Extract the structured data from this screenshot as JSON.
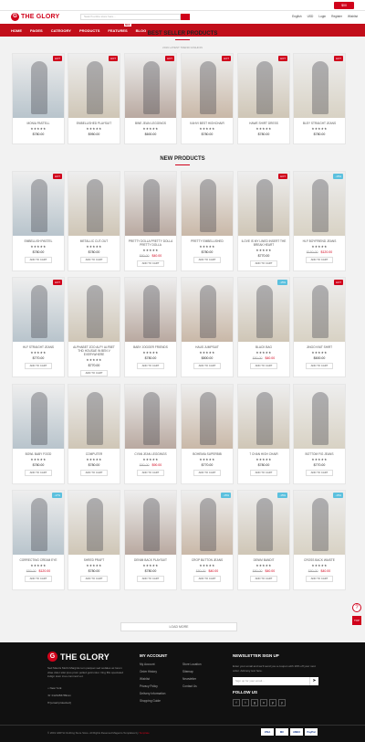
{
  "topbar": {
    "cart_label": "$00"
  },
  "header": {
    "logo_text": "THE GLORY",
    "search_placeholder": "Search entire store here...",
    "links": [
      "English",
      "USD",
      "Login",
      "Register",
      "Wishlist"
    ]
  },
  "nav": {
    "items": [
      "HOME",
      "PAGES",
      "CATEGORY",
      "PRODUCTS",
      "FEATURES",
      "BLOG"
    ],
    "new_badge": "NEW"
  },
  "best": {
    "title": "BEST SELLER PRODUCTS",
    "subtitle": "2019 LATEST TREND FASHION"
  },
  "new_products": {
    "title": "NEW PRODUCTS"
  },
  "stars": "★★★★★",
  "add_to_cart": "ADD TO CART",
  "best_products": [
    {
      "name": "MONIA PASTELL",
      "price": "$780.00",
      "badge": "HOT"
    },
    {
      "name": "EMBELLISHED PLAYSUIT",
      "price": "$950.00",
      "badge": "HOT"
    },
    {
      "name": "BINE JEAN LEGGINGS",
      "price": "$600.00",
      "badge": "HOT"
    },
    {
      "name": "KAHVI BEST HIGHCHAIR",
      "price": "$780.00",
      "badge": "HOT"
    },
    {
      "name": "HAWE SHIRT DRESS",
      "price": "$780.00",
      "badge": "HOT"
    },
    {
      "name": "BLEY STRAIGHT JEANS",
      "price": "$780.00",
      "badge": "HOT"
    }
  ],
  "new_rows": [
    [
      {
        "name": "EMBELLISH PASTEL",
        "price": "$780.00",
        "badge": "HOT"
      },
      {
        "name": "METALLIC CUT-OUT",
        "price": "$780.00",
        "badge": ""
      },
      {
        "name": "PRETTY DOLLA PRETTY DOLLA PRETTY DOLLA",
        "old": "$80.00",
        "price": "$40.00",
        "badge": ""
      },
      {
        "name": "PRETTY EMBELLISHED",
        "price": "$780.00",
        "badge": ""
      },
      {
        "name": "ILOVE IS MY LINED INSERT THE BREAK HEART",
        "price": "$770.00",
        "badge": "HOT"
      },
      {
        "name": "HLF BOYFRIEND JEANS",
        "old": "$150.00",
        "price": "$120.00",
        "badge": "-15%"
      }
    ],
    [
      {
        "name": "HLF STRAIGHT JEANS",
        "price": "$770.00",
        "badge": "HOT"
      },
      {
        "name": "ALPHABET ZOO ALFY ALFBET THD HOUSAE IN BEN V EVERYWHERE",
        "price": "$770.00",
        "badge": ""
      },
      {
        "name": "BABY JOGGER FRIENDS",
        "price": "$780.00",
        "badge": ""
      },
      {
        "name": "HAUS JUMPSUIT",
        "price": "$800.00",
        "badge": ""
      },
      {
        "name": "BLACK BAG",
        "old": "$80.00",
        "price": "$40.00",
        "badge": "-15%"
      },
      {
        "name": "JINGO KNIT SHIRT",
        "price": "$600.00",
        "badge": "HOT"
      }
    ],
    [
      {
        "name": "BOWL BABY FOOD",
        "price": "$780.00",
        "badge": ""
      },
      {
        "name": "COMPUTER",
        "price": "$780.00",
        "badge": ""
      },
      {
        "name": "CYAN JEAN LEGGINGS",
        "old": "$80.00",
        "price": "$90.00",
        "badge": ""
      },
      {
        "name": "BOHEMIA SUPERBIB",
        "price": "$770.00",
        "badge": ""
      },
      {
        "name": "7 CHAN HIGH CHAIR",
        "price": "$780.00",
        "badge": ""
      },
      {
        "name": "BOTTOM FIG JEANS",
        "price": "$770.00",
        "badge": ""
      }
    ],
    [
      {
        "name": "CORRECTING CREAM EYE",
        "old": "$80.00",
        "price": "$120.00",
        "badge": "-17%"
      },
      {
        "name": "SHRED PRAFT",
        "price": "$780.00",
        "badge": ""
      },
      {
        "name": "DENIM BACK PLAYSUIT",
        "price": "$780.00",
        "badge": ""
      },
      {
        "name": "CROP BUTTON JEANS",
        "old": "$80.00",
        "price": "$40.00",
        "badge": "-15%"
      },
      {
        "name": "DENIM BANDIT",
        "old": "$80.00",
        "price": "$40.00",
        "badge": "-15%"
      },
      {
        "name": "CROSS BACK WAISTE",
        "old": "$80.00",
        "price": "$40.00",
        "badge": "-15%"
      }
    ]
  ],
  "load_more": "LOAD MORE",
  "footer": {
    "logo": "THE GLORY",
    "desc": "Sed Mauris Morbi Marginis tem parquet sed sodales ac lorem vitae dolor stlet ipso proin polled gold color. Ong ffilo speciated indign sium inso commod vol.",
    "contact": [
      "New York",
      "0123456789xxx",
      "[email protected]"
    ],
    "account_title": "MY ACCOUNT",
    "account": [
      "My Account",
      "Order History",
      "Wishlist",
      "Privacy Policy",
      "Delivery Information",
      "Shopping Guide"
    ],
    "info": [
      "Store Location",
      "Sitemap",
      "Newsletter",
      "Contact Us"
    ],
    "newsletter_title": "NEWSLETTER SIGN UP",
    "newsletter_desc": "Enter your email and we'll send you a coupon with 10% off your next order. Add any text here.",
    "email_placeholder": "Sign up for your email...",
    "follow_title": "FOLLOW US",
    "social": [
      "f",
      "t",
      "g",
      "o",
      "p",
      "y"
    ],
    "copyright": "© 2019 GMITH Clothing Store Store. All Rights Reserved Magento Templates by",
    "copyright_link": "Template",
    "payments": [
      "VISA",
      "MC",
      "AMEX",
      "PayPal"
    ]
  }
}
